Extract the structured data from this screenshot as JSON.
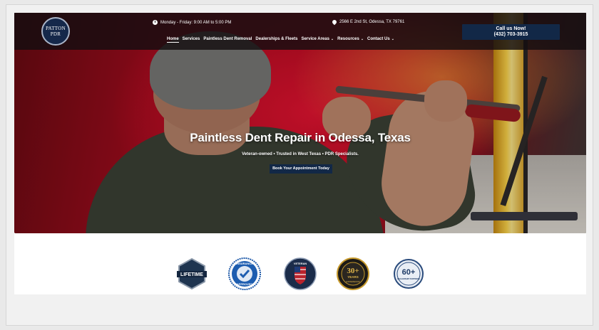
{
  "logo": {
    "line1": "PATTON",
    "line2": "PDR"
  },
  "header": {
    "hours": "Monday - Friday: 9:00 AM to 5:00 PM",
    "address": "2566 E 2nd St, Odessa, TX 79761",
    "call_line1": "Call us Now!",
    "call_line2": "(432) 703-3915"
  },
  "nav": {
    "items": [
      {
        "label": "Home",
        "dropdown": false
      },
      {
        "label": "Services",
        "dropdown": false
      },
      {
        "label": "Paintless Dent Removal",
        "dropdown": false
      },
      {
        "label": "Dealerships & Fleets",
        "dropdown": false
      },
      {
        "label": "Service Areas",
        "dropdown": true
      },
      {
        "label": "Resources",
        "dropdown": true
      },
      {
        "label": "Contact Us",
        "dropdown": true
      }
    ],
    "active": "Home",
    "chevron": "⌄"
  },
  "hero": {
    "title": "Paintless Dent Repair in Odessa, Texas",
    "subtitle": "Veteran-owned • Trusted in West Texas • PDR Specialists.",
    "cta": "Book Your Appointment Today"
  },
  "badges": {
    "lifetime": "LIFETIME",
    "insurance_top": "INSURANCE",
    "insurance_bottom": "APPROVED",
    "veteran": "VETERAN",
    "years_num": "30+",
    "years_word": "YEARS",
    "years_sub": "EXPERIENCE",
    "dealer_num": "60+",
    "dealer_sub": "DEALERSHIP PARTNERS"
  },
  "colors": {
    "navy": "#122847",
    "gold": "#c79a2c",
    "red": "#c3142a"
  }
}
